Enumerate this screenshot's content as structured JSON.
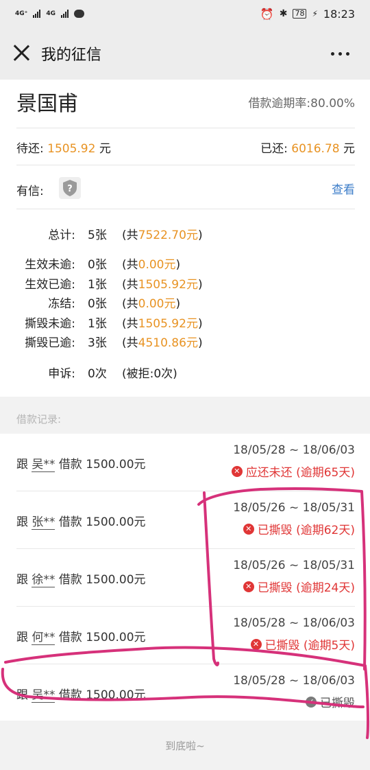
{
  "status_bar": {
    "network_1": "4G⁺",
    "network_2": "4G",
    "battery": "78",
    "time": "18:23"
  },
  "nav": {
    "title": "我的征信"
  },
  "profile": {
    "name": "景国甫",
    "overdue_rate_label": "借款逾期率:",
    "overdue_rate": "80.00%",
    "pending_label": "待还:",
    "pending_amount": "1505.92",
    "pending_unit": "元",
    "paid_label": "已还:",
    "paid_amount": "6016.78",
    "paid_unit": "元",
    "youxin_label": "有信:",
    "view_label": "查看"
  },
  "stats": [
    {
      "label": "总计:",
      "count": "5张",
      "prefix": "(共",
      "amount": "7522.70元",
      "suffix": ")"
    },
    {
      "label": "生效未逾:",
      "count": "0张",
      "prefix": "(共",
      "amount": "0.00元",
      "suffix": ")"
    },
    {
      "label": "生效已逾:",
      "count": "1张",
      "prefix": "(共",
      "amount": "1505.92元",
      "suffix": ")"
    },
    {
      "label": "冻结:",
      "count": "0张",
      "prefix": "(共",
      "amount": "0.00元",
      "suffix": ")"
    },
    {
      "label": "撕毁未逾:",
      "count": "1张",
      "prefix": "(共",
      "amount": "1505.92元",
      "suffix": ")"
    },
    {
      "label": "撕毁已逾:",
      "count": "3张",
      "prefix": "(共",
      "amount": "4510.86元",
      "suffix": ")"
    }
  ],
  "appeal": {
    "label": "申诉:",
    "count": "0次",
    "rejected": "(被拒:0次)"
  },
  "records_title": "借款记录:",
  "records": [
    {
      "prefix": "跟",
      "lender": "吴**",
      "desc": "借款 1500.00元",
      "date": "18/05/28 ~ 18/06/03",
      "status": "应还未还 (逾期65天)",
      "state": "error"
    },
    {
      "prefix": "跟",
      "lender": "张**",
      "desc": "借款 1500.00元",
      "date": "18/05/26 ~ 18/05/31",
      "status": "已撕毁 (逾期62天)",
      "state": "error"
    },
    {
      "prefix": "跟",
      "lender": "徐**",
      "desc": "借款 1500.00元",
      "date": "18/05/26 ~ 18/05/31",
      "status": "已撕毁 (逾期24天)",
      "state": "error"
    },
    {
      "prefix": "跟",
      "lender": "何**",
      "desc": "借款 1500.00元",
      "date": "18/05/28 ~ 18/06/03",
      "status": "已撕毁 (逾期5天)",
      "state": "error"
    },
    {
      "prefix": "跟",
      "lender": "吴**",
      "desc": "借款 1500.00元",
      "date": "18/05/28 ~ 18/06/03",
      "status": "已撕毁",
      "state": "done"
    }
  ],
  "footer": "到底啦~",
  "colors": {
    "accent_orange": "#e89323",
    "error_red": "#e03636",
    "link_blue": "#3c7dc9",
    "annotation_magenta": "#d6317a"
  }
}
